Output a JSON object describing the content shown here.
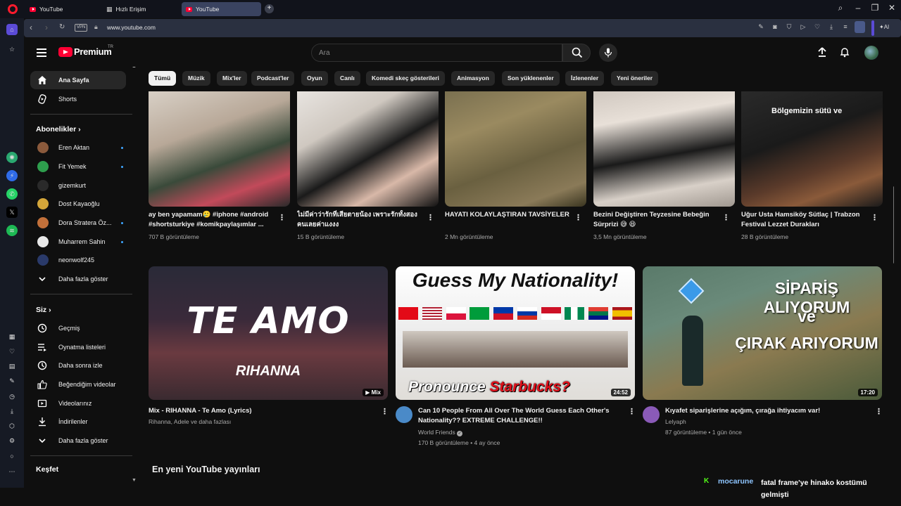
{
  "browser": {
    "tabs": [
      {
        "label": "YouTube",
        "active": false
      },
      {
        "label": "Hızlı Erişim",
        "active": false
      },
      {
        "label": "YouTube",
        "active": true
      }
    ],
    "url": "www.youtube.com",
    "vpn_label": "VPN",
    "ai_label": "AI"
  },
  "header": {
    "brand": "Premium",
    "country": "TR",
    "search_placeholder": "Ara"
  },
  "guide": {
    "main": [
      {
        "label": "Ana Sayfa",
        "icon": "home-icon",
        "active": true
      },
      {
        "label": "Shorts",
        "icon": "shorts-icon",
        "active": false
      }
    ],
    "subscriptions_title": "Abonelikler",
    "subscriptions": [
      {
        "label": "Eren Aktan",
        "color": "#8b5a3c",
        "new": true
      },
      {
        "label": "Fit Yemek",
        "color": "#2e9e4d",
        "new": true
      },
      {
        "label": "gizemkurt",
        "color": "#2a2a2a",
        "new": false
      },
      {
        "label": "Dost Kayaoğlu",
        "color": "#d4a63a",
        "new": false
      },
      {
        "label": "Dora Stratera Öz...",
        "color": "#c2703a",
        "new": true
      },
      {
        "label": "Muharrem Sahin",
        "color": "#e8e8e8",
        "new": true
      },
      {
        "label": "neonwolf245",
        "color": "#2a3a6a",
        "new": false
      }
    ],
    "subs_more": "Daha fazla göster",
    "you_title": "Siz",
    "you": [
      {
        "label": "Geçmiş",
        "icon": "history-icon"
      },
      {
        "label": "Oynatma listeleri",
        "icon": "playlists-icon"
      },
      {
        "label": "Daha sonra izle",
        "icon": "watch-later-icon"
      },
      {
        "label": "Beğendiğim videolar",
        "icon": "like-icon"
      },
      {
        "label": "Videolarınız",
        "icon": "your-videos-icon"
      },
      {
        "label": "İndirilenler",
        "icon": "downloads-icon"
      },
      {
        "label": "Daha fazla göster",
        "icon": "chevron-down-icon"
      }
    ],
    "explore_title": "Keşfet"
  },
  "chips": [
    "Tümü",
    "Müzik",
    "Mix'ler",
    "Podcast'ler",
    "Oyun",
    "Canlı",
    "Komedi skeç gösterileri",
    "Animasyon",
    "Son yüklenenler",
    "İzlenenler",
    "Yeni öneriler"
  ],
  "shorts": [
    {
      "title": "ay ben yapamam🥲 #iphone #android #shortsturkiye #komikpaylaşımlar ...",
      "views": "707 B görüntüleme"
    },
    {
      "title": "ไม่มีค่าว่ารักที่เสียตายน้อง เพราะรักทั้งสองคนเลยค่าแงงง",
      "views": "15 B görüntüleme"
    },
    {
      "title": "HAYATI KOLAYLAŞTIRAN TAVSİYELER",
      "views": "2 Mn görüntüleme"
    },
    {
      "title": "Bezini Değiştiren Teyzesine Bebeğin Sürprizi 😅 😆",
      "views": "3,5 Mn görüntüleme"
    },
    {
      "title": "Uğur Usta Hamsiköy Sütlaç | Trabzon Festival Lezzet Durakları",
      "views": "28 B görüntüleme",
      "overlay": "Bölgemizin sütü ve"
    }
  ],
  "videos": [
    {
      "title": "Mix - RIHANNA - Te Amo  (Lyrics)",
      "channel": "Rihanna, Adele ve daha fazlası",
      "stats": "",
      "badge": "Mix",
      "thumb_big": "TE AMO",
      "thumb_small": "RIHANNA"
    },
    {
      "title": "Can 10 People From All Over The World Guess Each Other's Nationality?? EXTREME CHALLENGE!!",
      "channel": "World Friends",
      "stats": "170 B görüntüleme • 4 ay önce",
      "badge": "24:52",
      "thumb_big": "Guess My Nationality!",
      "thumb_small": "Pronounce",
      "thumb_small2": "Starbucks?"
    },
    {
      "title": "Kıyafet siparişlerine açığım, çırağa ihtiyacım var!",
      "channel": "Lelyaph",
      "stats": "87 görüntüleme • 1 gün önce",
      "badge": "17:20",
      "thumb_line1": "SİPARİŞ ALIYORUM",
      "thumb_line2": "ve",
      "thumb_line3": "ÇIRAK ARIYORUM"
    }
  ],
  "section_title": "En yeni YouTube yayınları",
  "chat_overlay": {
    "user": "mocarune",
    "message": "fatal frame'ye hinako kostümü gelmişti"
  }
}
